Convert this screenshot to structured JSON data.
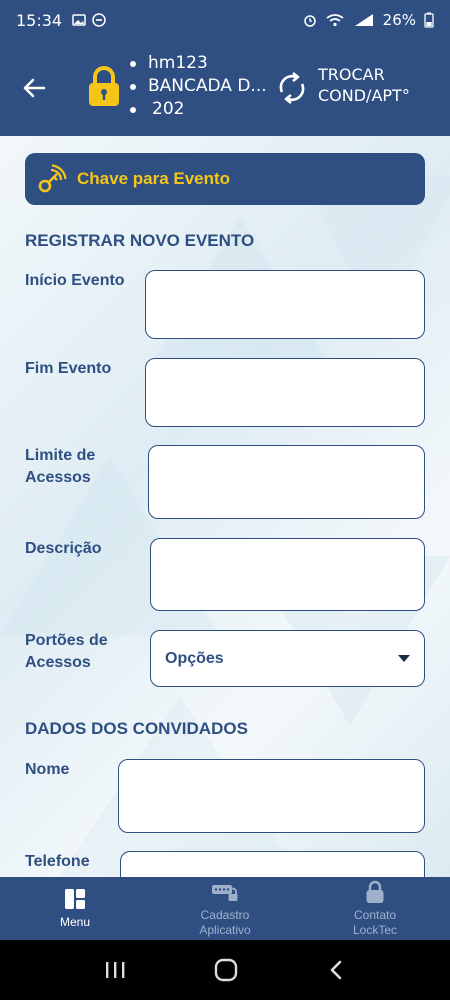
{
  "status_bar": {
    "time": "15:34",
    "battery": "26%"
  },
  "header": {
    "info": [
      "hm123",
      "BANCADA D...",
      "202"
    ],
    "switch_label_line1": "TROCAR",
    "switch_label_line2": "COND/APT°"
  },
  "event_key": {
    "label": "Chave para Evento"
  },
  "register_section": {
    "title": "REGISTRAR NOVO EVENTO",
    "fields": {
      "start_label": "Início Evento",
      "end_label": "Fim Evento",
      "limit_label_line1": "Limite de",
      "limit_label_line2": "Acessos",
      "description_label": "Descrição",
      "gates_label_line1": "Portões de",
      "gates_label_line2": "Acessos",
      "gates_selected": "Opções"
    }
  },
  "guests_section": {
    "title": "DADOS DOS CONVIDADOS",
    "name_label": "Nome",
    "phone_label": "Telefone"
  },
  "bottom_nav": {
    "items": [
      {
        "label": "Menu",
        "icon": "menu-grid-icon",
        "active": true
      },
      {
        "label_line1": "Cadastro",
        "label_line2": "Aplicativo",
        "icon": "keypad-lock-icon",
        "active": false
      },
      {
        "label_line1": "Contato",
        "label_line2": "LockTec",
        "icon": "lock-icon",
        "active": false
      }
    ]
  },
  "colors": {
    "primary": "#2f4f83",
    "accent": "#f5c518"
  }
}
